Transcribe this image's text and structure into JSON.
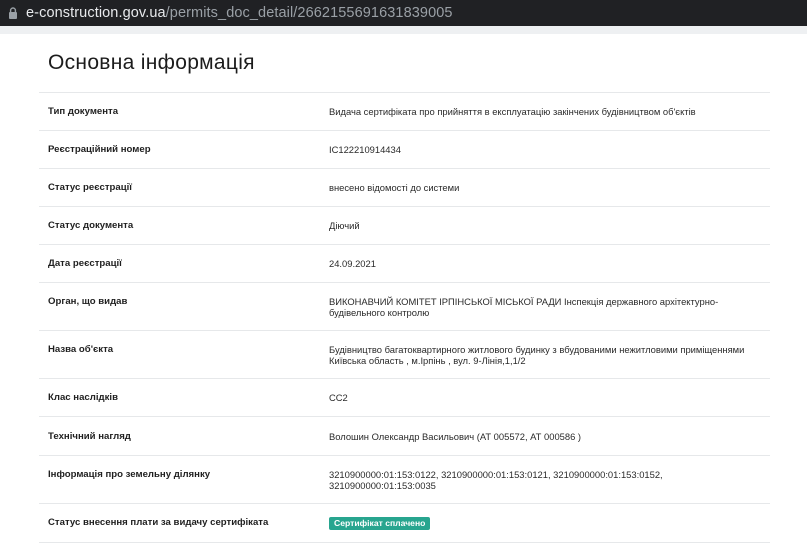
{
  "browser": {
    "url_domain": "e-construction.gov.ua",
    "url_path": "/permits_doc_detail/2662155691631839005"
  },
  "page": {
    "title": "Основна інформація"
  },
  "rows": [
    {
      "label": "Тип документа",
      "value": "Видача сертифіката про прийняття в експлуатацію закінчених будівництвом об'єктів"
    },
    {
      "label": "Реєстраційний номер",
      "value": "ІС122210914434"
    },
    {
      "label": "Статус реєстрації",
      "value": "внесено відомості до системи"
    },
    {
      "label": "Статус документа",
      "value": "Діючий"
    },
    {
      "label": "Дата реєстрації",
      "value": "24.09.2021"
    },
    {
      "label": "Орган, що видав",
      "value": "ВИКОНАВЧИЙ КОМІТЕТ ІРПІНСЬКОЇ МІСЬКОЇ РАДИ Інспекція державного архітектурно-будівельного контролю"
    },
    {
      "label": "Назва об'єкта",
      "value": "Будівництво багатоквартирного житлового будинку з вбудованими нежитловими приміщеннями Київська область , м.Ірпінь , вул. 9-Лінія,1,1/2"
    },
    {
      "label": "Клас наслідків",
      "value": "СС2"
    },
    {
      "label": "Технічний нагляд",
      "value": "Волошин Олександр Васильович (АТ 005572, АТ 000586 )"
    },
    {
      "label": "Інформація про земельну ділянку",
      "value": "3210900000:01:153:0122, 3210900000:01:153:0121, 3210900000:01:153:0152, 3210900000:01:153:0035"
    },
    {
      "label": "Статус внесення плати за видачу сертифіката",
      "badge": "Сертифікат сплачено"
    }
  ],
  "colors": {
    "badge_bg": "#28a58f",
    "address_bar_bg": "#202124"
  },
  "icons": {
    "address_bar": "lock-icon"
  }
}
